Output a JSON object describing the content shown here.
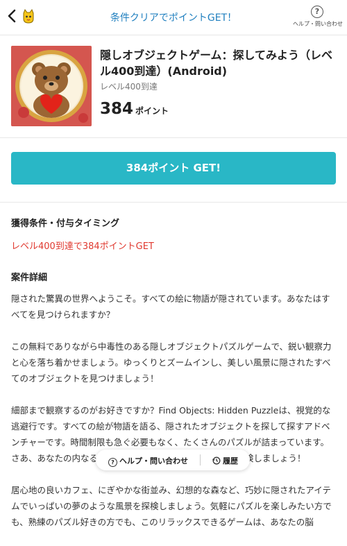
{
  "header": {
    "title": "条件クリアでポイントGET！",
    "help_label": "ヘルプ・問い合わせ",
    "back_icon": "chevron-left-icon",
    "help_icon": "question-circle-icon"
  },
  "offer": {
    "title": "隠しオブジェクトゲーム：探してみよう（レベル400到達）(Android)",
    "subtitle": "レベル400到達",
    "points": "384",
    "points_unit": "ポイント"
  },
  "get_button": {
    "label": "384ポイント GET!"
  },
  "conditions": {
    "heading": "獲得条件・付与タイミング",
    "text": "レベル400到達で384ポイントGET"
  },
  "details": {
    "heading": "案件詳細",
    "paragraphs": [
      "隠された驚異の世界へようこそ。すべての絵に物語が隠されています。あなたはすべてを見つけられますか？",
      "この無料でありながら中毒性のある隠しオブジェクトパズルゲームで、鋭い観察力と心を落ち着かせましょう。ゆっくりとズームインし、美しい風景に隠されたすべてのオブジェクトを見つけましょう！",
      "細部まで観察するのがお好きですか？Find Objects: Hidden Puzzleは、視覚的な逃避行です。すべての絵が物語を語る、隠されたオブジェクトを探して探すアドベンチャーです。時間制限も急ぐ必要もなく、たくさんのパズルが詰まっています。さあ、あなたの内なる探偵魂を解き放ち、自分のペースで探検しましょう！",
      "居心地の良いカフェ、にぎやかな街並み、幻想的な森など、巧妙に隠されたアイテムでいっぱいの夢のような風景を探検しましょう。気軽にパズルを楽しみたい方でも、熟練のパズル好きの方でも、このリラックスできるゲームは、あなたの脳"
    ]
  },
  "float_bar": {
    "help_label": "ヘルプ・問い合わせ",
    "history_label": "履歴",
    "help_icon": "question-circle-icon",
    "history_icon": "clock-history-icon"
  },
  "colors": {
    "accent": "#29b7c6",
    "header_title": "#1f7fbf",
    "condition_red": "#e0392f"
  }
}
